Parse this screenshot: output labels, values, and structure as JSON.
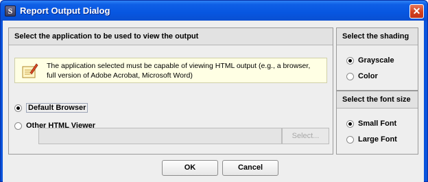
{
  "window": {
    "title": "Report Output Dialog",
    "icon_letter": "S",
    "close_glyph": "✕"
  },
  "app_panel": {
    "header": "Select the application to be used to view the output",
    "info_text": "The application selected must be capable of viewing HTML output (e.g., a browser, full version of Adobe Acrobat, Microsoft Word)",
    "options": [
      {
        "label": "Default Browser",
        "selected": true
      },
      {
        "label": "Other HTML Viewer",
        "selected": false
      }
    ],
    "viewer_path": {
      "value": ""
    },
    "select_button": "Select..."
  },
  "shading_panel": {
    "header": "Select the shading",
    "options": [
      {
        "label": "Grayscale",
        "selected": true
      },
      {
        "label": "Color",
        "selected": false
      }
    ]
  },
  "font_panel": {
    "header": "Select the font size",
    "options": [
      {
        "label": "Small Font",
        "selected": true
      },
      {
        "label": "Large Font",
        "selected": false
      }
    ]
  },
  "buttons": {
    "ok": "OK",
    "cancel": "Cancel"
  },
  "colors": {
    "titlebar": "#0756e0",
    "close_button": "#d2401e",
    "info_background": "#ffffe4"
  }
}
